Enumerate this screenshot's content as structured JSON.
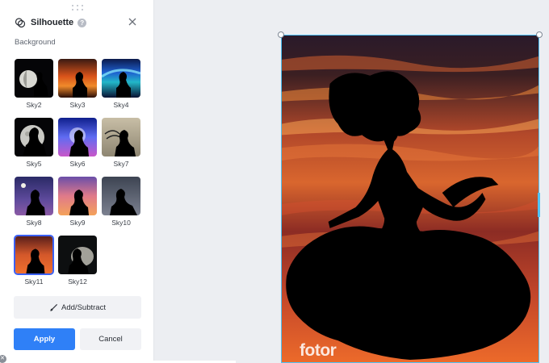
{
  "panel": {
    "title": "Silhouette",
    "help_glyph": "?",
    "section_label": "Background",
    "presets": [
      {
        "label": "Sky2",
        "selected": false
      },
      {
        "label": "Sky3",
        "selected": false
      },
      {
        "label": "Sky4",
        "selected": false
      },
      {
        "label": "Sky5",
        "selected": false
      },
      {
        "label": "Sky6",
        "selected": false
      },
      {
        "label": "Sky7",
        "selected": false
      },
      {
        "label": "Sky8",
        "selected": false
      },
      {
        "label": "Sky9",
        "selected": false
      },
      {
        "label": "Sky10",
        "selected": false
      },
      {
        "label": "Sky11",
        "selected": true
      },
      {
        "label": "Sky12",
        "selected": false
      }
    ],
    "add_subtract_label": "Add/Subtract",
    "apply_label": "Apply",
    "cancel_label": "Cancel"
  },
  "canvas": {
    "watermark": "fotor"
  },
  "colors": {
    "accent": "#2f80f7",
    "selection": "#3b61f5",
    "canvas_border": "#4fc3f7"
  },
  "icons": {
    "tool": "silhouette-icon",
    "help": "help-icon",
    "close": "close-icon",
    "brush": "brush-icon",
    "drag": "drag-handle-icon"
  }
}
